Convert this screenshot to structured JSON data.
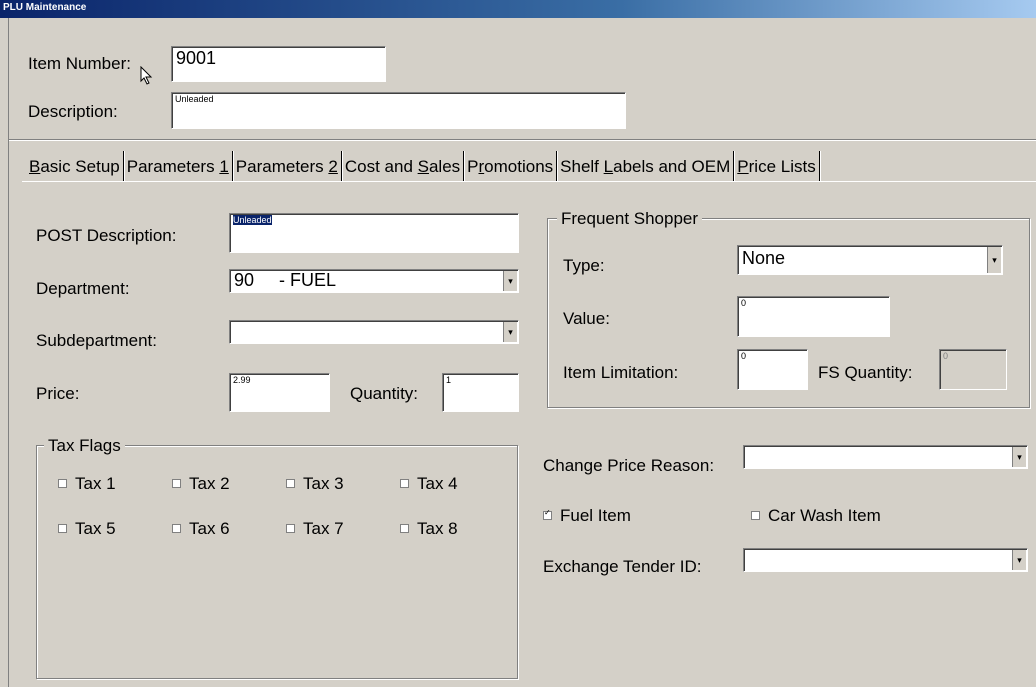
{
  "window": {
    "title": "PLU Maintenance"
  },
  "header": {
    "item_number_label": "Item Number:",
    "item_number_value": "9001",
    "description_label": "Description:",
    "description_value": "Unleaded"
  },
  "tabs": [
    {
      "label": "Basic Setup",
      "active": true
    },
    {
      "label": "Parameters 1"
    },
    {
      "label": "Parameters 2"
    },
    {
      "label": "Cost and Sales"
    },
    {
      "label": "Promotions"
    },
    {
      "label": "Shelf Labels and OEM"
    },
    {
      "label": "Price Lists"
    }
  ],
  "basic": {
    "post_desc_label": "POST Description:",
    "post_desc_value": "Unleaded",
    "department_label": "Department:",
    "department_value": "90     - FUEL",
    "subdepartment_label": "Subdepartment:",
    "subdepartment_value": "",
    "price_label": "Price:",
    "price_value": "2.99",
    "quantity_label": "Quantity:",
    "quantity_value": "1"
  },
  "tax_flags": {
    "legend": "Tax Flags",
    "items": [
      "Tax 1",
      "Tax 2",
      "Tax 3",
      "Tax 4",
      "Tax 5",
      "Tax 6",
      "Tax 7",
      "Tax 8"
    ]
  },
  "frequent_shopper": {
    "legend": "Frequent Shopper",
    "type_label": "Type:",
    "type_value": "None",
    "value_label": "Value:",
    "value_value": "0",
    "item_limit_label": "Item Limitation:",
    "item_limit_value": "0",
    "fs_qty_label": "FS Quantity:",
    "fs_qty_value": "0"
  },
  "extras": {
    "change_price_label": "Change Price Reason:",
    "change_price_value": "",
    "fuel_item_label": "Fuel Item",
    "fuel_item_checked": true,
    "car_wash_label": "Car Wash Item",
    "car_wash_checked": false,
    "exchange_tender_label": "Exchange Tender ID:",
    "exchange_tender_value": ""
  }
}
